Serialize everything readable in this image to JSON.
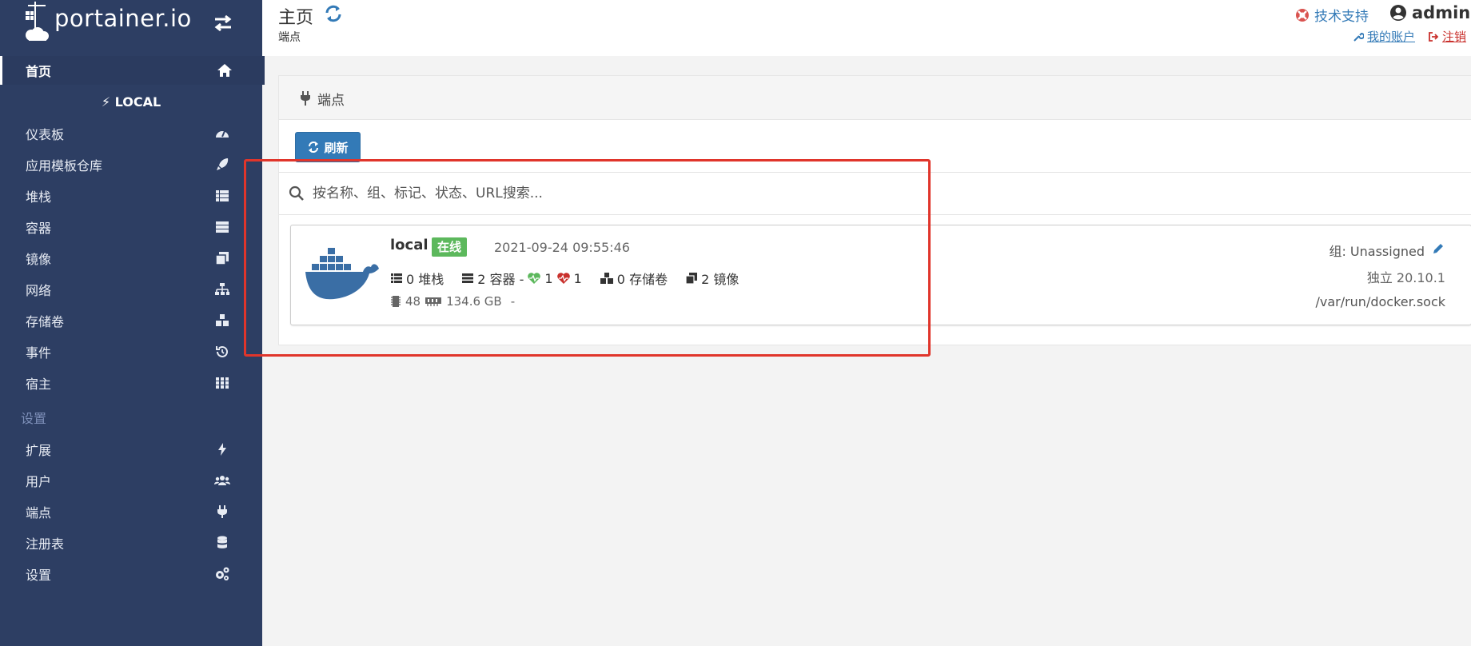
{
  "sidebar": {
    "brand": "portainer.io",
    "home_label": "首页",
    "endpoint_name": "LOCAL",
    "items": [
      {
        "label": "仪表板",
        "icon": "tachometer-icon"
      },
      {
        "label": "应用模板仓库",
        "icon": "rocket-icon"
      },
      {
        "label": "堆栈",
        "icon": "th-list-icon"
      },
      {
        "label": "容器",
        "icon": "server-icon"
      },
      {
        "label": "镜像",
        "icon": "clone-icon"
      },
      {
        "label": "网络",
        "icon": "sitemap-icon"
      },
      {
        "label": "存储卷",
        "icon": "cubes-icon"
      },
      {
        "label": "事件",
        "icon": "history-icon"
      },
      {
        "label": "宿主",
        "icon": "th-icon"
      }
    ],
    "settings_section": "设置",
    "settings_items": [
      {
        "label": "扩展",
        "icon": "bolt-icon"
      },
      {
        "label": "用户",
        "icon": "users-icon"
      },
      {
        "label": "端点",
        "icon": "plug-icon"
      },
      {
        "label": "注册表",
        "icon": "database-icon"
      },
      {
        "label": "设置",
        "icon": "cogs-icon"
      }
    ]
  },
  "header": {
    "title": "主页",
    "breadcrumb": "端点",
    "support": "技术支持",
    "user": "admin",
    "my_account": "我的账户",
    "logout": "注销"
  },
  "widget": {
    "title": "端点",
    "refresh_button": "刷新",
    "search_placeholder": "按名称、组、标记、状态、URL搜索..."
  },
  "endpoint": {
    "name": "local",
    "status": "在线",
    "timestamp": "2021-09-24 09:55:46",
    "stacks": "0 堆栈",
    "containers": "2 容器 -",
    "healthy": "1",
    "unhealthy": "1",
    "volumes": "0 存储卷",
    "images": "2 镜像",
    "cpu": "48",
    "memory": "134.6 GB",
    "memory_suffix": "-",
    "group": "组: Unassigned",
    "version": "独立 20.10.1",
    "url": "/var/run/docker.sock"
  },
  "colors": {
    "sidebar_bg": "#2d3e63",
    "accent": "#337ab7",
    "online": "#5cb85c",
    "highlight": "#e0352b",
    "docker_blue": "#3a6ea5"
  }
}
